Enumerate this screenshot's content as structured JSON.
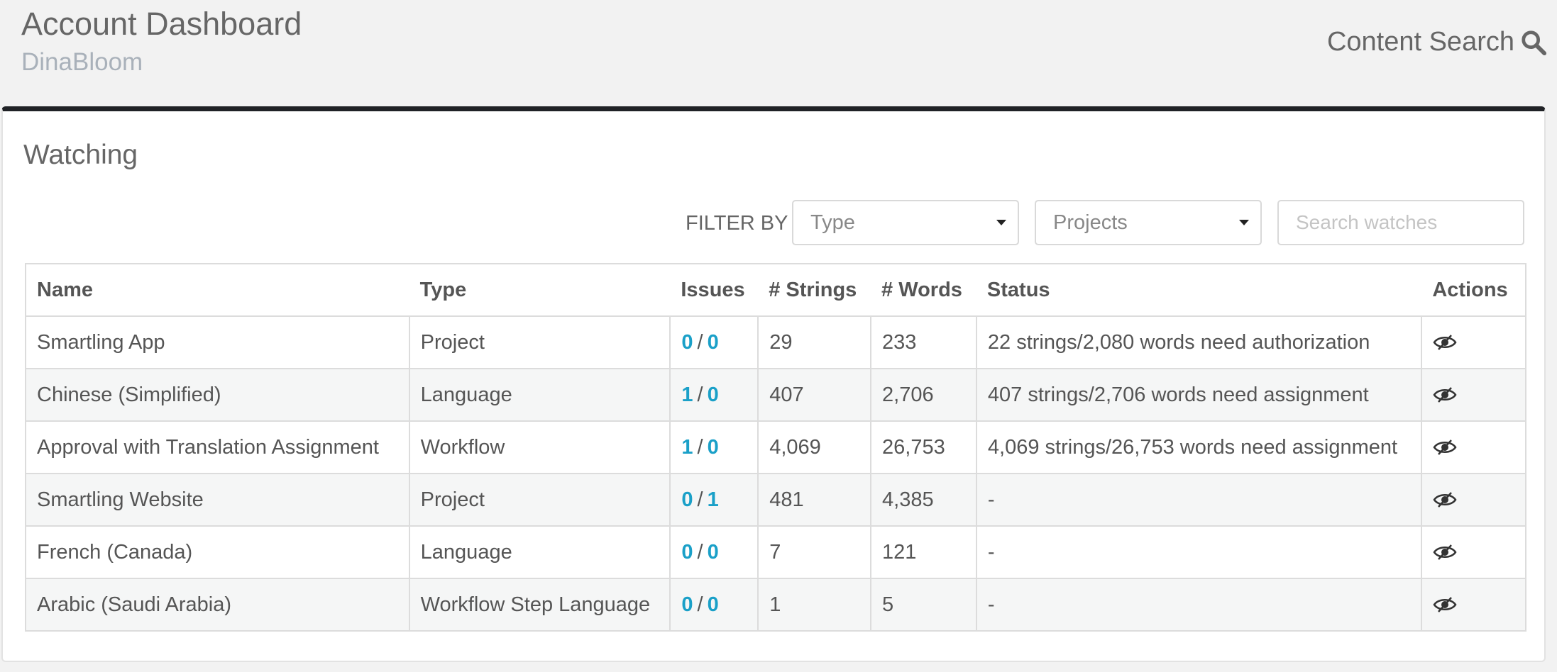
{
  "header": {
    "title": "Account Dashboard",
    "subtitle": "DinaBloom",
    "content_search_label": "Content Search"
  },
  "panel": {
    "title": "Watching",
    "filter_label": "FILTER BY",
    "type_select": "Type",
    "projects_select": "Projects",
    "search_placeholder": "Search watches"
  },
  "table": {
    "columns": [
      "Name",
      "Type",
      "Issues",
      "# Strings",
      "# Words",
      "Status",
      "Actions"
    ],
    "rows": [
      {
        "name": "Smartling App",
        "type": "Project",
        "issues_a": "0",
        "issues_b": "0",
        "strings": "29",
        "words": "233",
        "status": "22 strings/2,080 words need authorization"
      },
      {
        "name": "Chinese (Simplified)",
        "type": "Language",
        "issues_a": "1",
        "issues_b": "0",
        "strings": "407",
        "words": "2,706",
        "status": "407 strings/2,706 words need assignment"
      },
      {
        "name": "Approval with Translation Assignment",
        "type": "Workflow",
        "issues_a": "1",
        "issues_b": "0",
        "strings": "4,069",
        "words": "26,753",
        "status": "4,069 strings/26,753 words need assignment"
      },
      {
        "name": "Smartling Website",
        "type": "Project",
        "issues_a": "0",
        "issues_b": "1",
        "strings": "481",
        "words": "4,385",
        "status": "-"
      },
      {
        "name": "French (Canada)",
        "type": "Language",
        "issues_a": "0",
        "issues_b": "0",
        "strings": "7",
        "words": "121",
        "status": "-"
      },
      {
        "name": "Arabic (Saudi Arabia)",
        "type": "Workflow Step Language",
        "issues_a": "0",
        "issues_b": "0",
        "strings": "1",
        "words": "5",
        "status": "-"
      }
    ]
  },
  "icons": {
    "search": "search-icon",
    "unwatch": "eye-slash-icon"
  },
  "colors": {
    "accent": "#1aa0c8",
    "panel_top_border": "#202226"
  }
}
